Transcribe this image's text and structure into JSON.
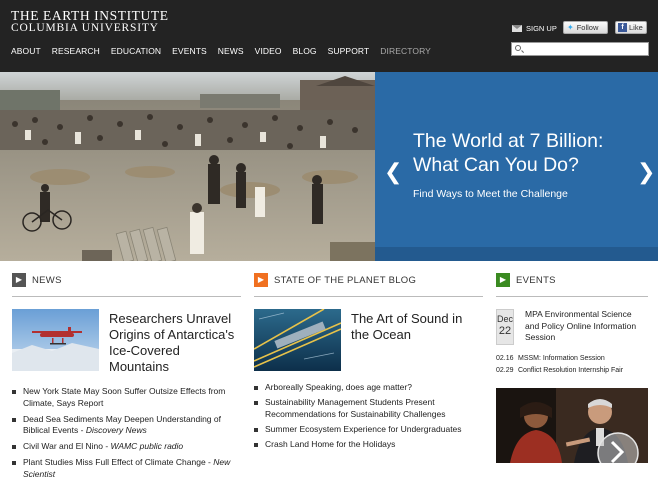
{
  "header": {
    "logo_line1": "THE EARTH INSTITUTE",
    "logo_line2": "COLUMBIA UNIVERSITY",
    "signup_label": "SIGN UP",
    "twitter_label": "Follow",
    "facebook_label": "Like",
    "search_value": "",
    "nav": [
      "ABOUT",
      "RESEARCH",
      "EDUCATION",
      "EVENTS",
      "NEWS",
      "VIDEO",
      "BLOG",
      "SUPPORT",
      "DIRECTORY"
    ]
  },
  "hero": {
    "title": "The World at 7 Billion: What Can You Do?",
    "subtitle": "Find Ways to Meet the Challenge",
    "panel_color": "#2a6aa6"
  },
  "news": {
    "heading": "NEWS",
    "heading_color": "#555555",
    "feature_title": "Researchers Unravel Origins of Antarctica's Ice-Covered Mountains",
    "items": [
      {
        "text": "New York State May Soon Suffer Outsize Effects from Climate, Says Report",
        "source": ""
      },
      {
        "text": "Dead Sea Sediments May Deepen Understanding of Biblical Events - ",
        "source": "Discovery News"
      },
      {
        "text": "Civil War and El Nino - ",
        "source": "WAMC public radio"
      },
      {
        "text": "Plant Studies Miss Full Effect of Climate Change - ",
        "source": "New Scientist"
      }
    ]
  },
  "blog": {
    "heading": "STATE OF THE PLANET BLOG",
    "heading_color": "#f07020",
    "feature_title": "The Art of Sound in the Ocean",
    "items": [
      "Arboreally Speaking, does age matter?",
      "Sustainability Management Students Present Recommendations for Sustainability Challenges",
      "Summer Ecosystem Experience for Undergraduates",
      "Crash Land Home for the Holidays"
    ]
  },
  "events": {
    "heading": "EVENTS",
    "heading_color": "#3a8a20",
    "feature_month": "Dec",
    "feature_day": "22",
    "feature_title": "MPA Environmental Science and Policy Online Information Session",
    "items": [
      {
        "date": "02.16",
        "text": "MSSM: Information Session"
      },
      {
        "date": "02.29",
        "text": "Conflict Resolution Internship Fair"
      }
    ]
  }
}
